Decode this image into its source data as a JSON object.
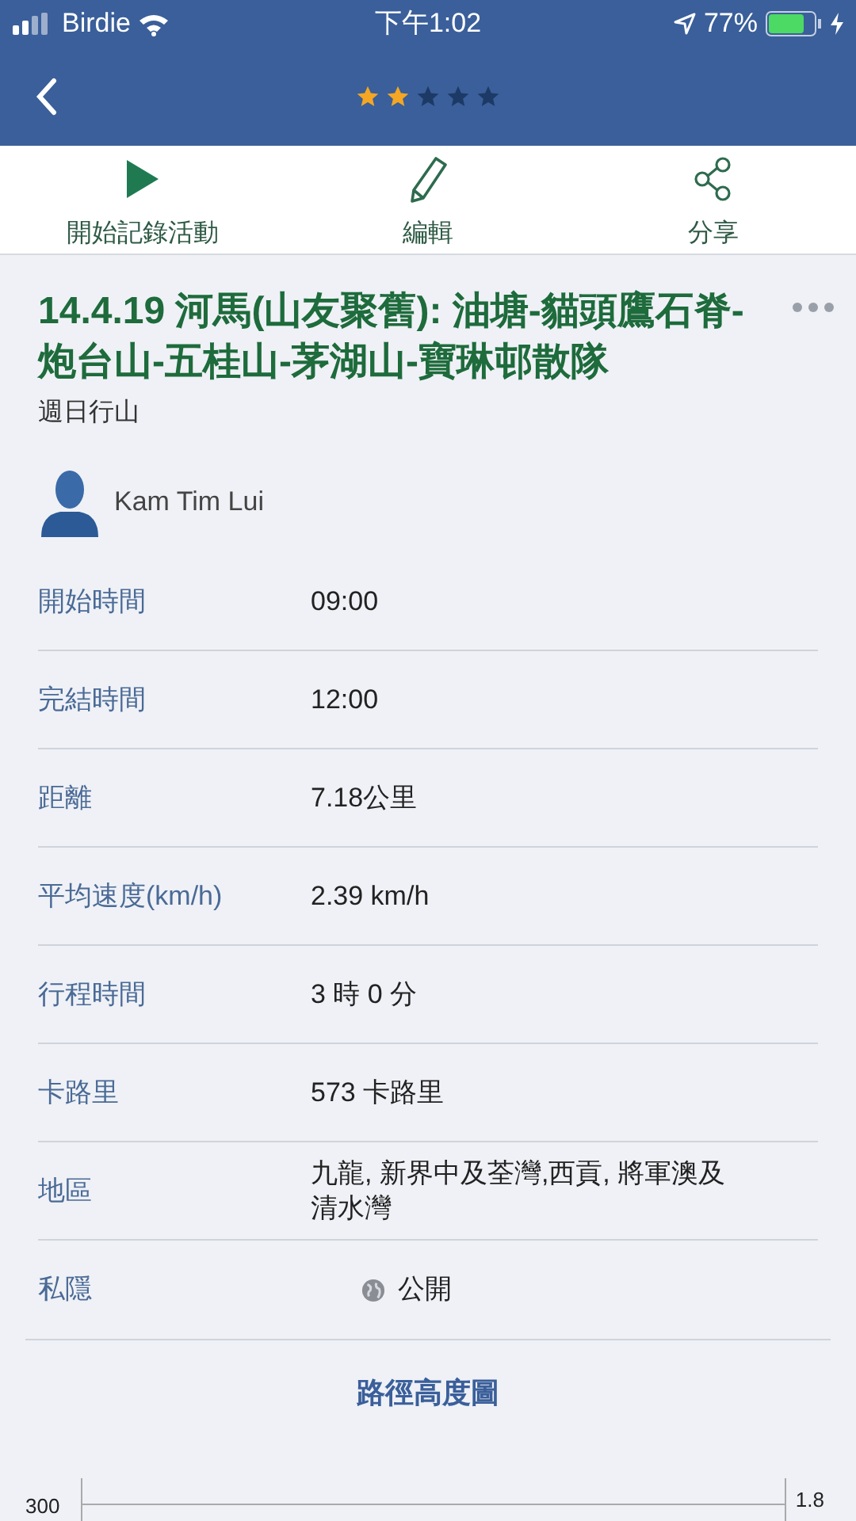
{
  "status_bar": {
    "carrier": "Birdie",
    "time": "下午1:02",
    "battery": "77%"
  },
  "nav": {
    "stars": 2
  },
  "actions": [
    {
      "kind": "record",
      "label": "開始記錄活動"
    },
    {
      "kind": "edit",
      "label": "編輯"
    },
    {
      "kind": "share",
      "label": "分享"
    }
  ],
  "title": "14.4.19 河馬(山友聚舊): 油塘-貓頭鷹石脊-炮台山-五桂山-茅湖山-寶琳邨散隊",
  "subtitle": "週日行山",
  "author": "Kam Tim Lui",
  "details": [
    {
      "label": "開始時間",
      "value": "09:00"
    },
    {
      "label": "完結時間",
      "value": "12:00"
    },
    {
      "label": "距離",
      "value": "7.18公里"
    },
    {
      "label": "平均速度(km/h)",
      "value": "2.39 km/h"
    },
    {
      "label": "行程時間",
      "value": "3 時 0 分"
    },
    {
      "label": "卡路里",
      "value": "573 卡路里"
    },
    {
      "label": "地區",
      "value": "九龍, 新界中及荃灣,西貢, 將軍澳及清水灣"
    },
    {
      "label": "私隱",
      "value": "公開",
      "kind": "privacy"
    }
  ],
  "chart": {
    "title": "路徑高度圖",
    "left_tick": "300",
    "right_tick": "1.8"
  }
}
